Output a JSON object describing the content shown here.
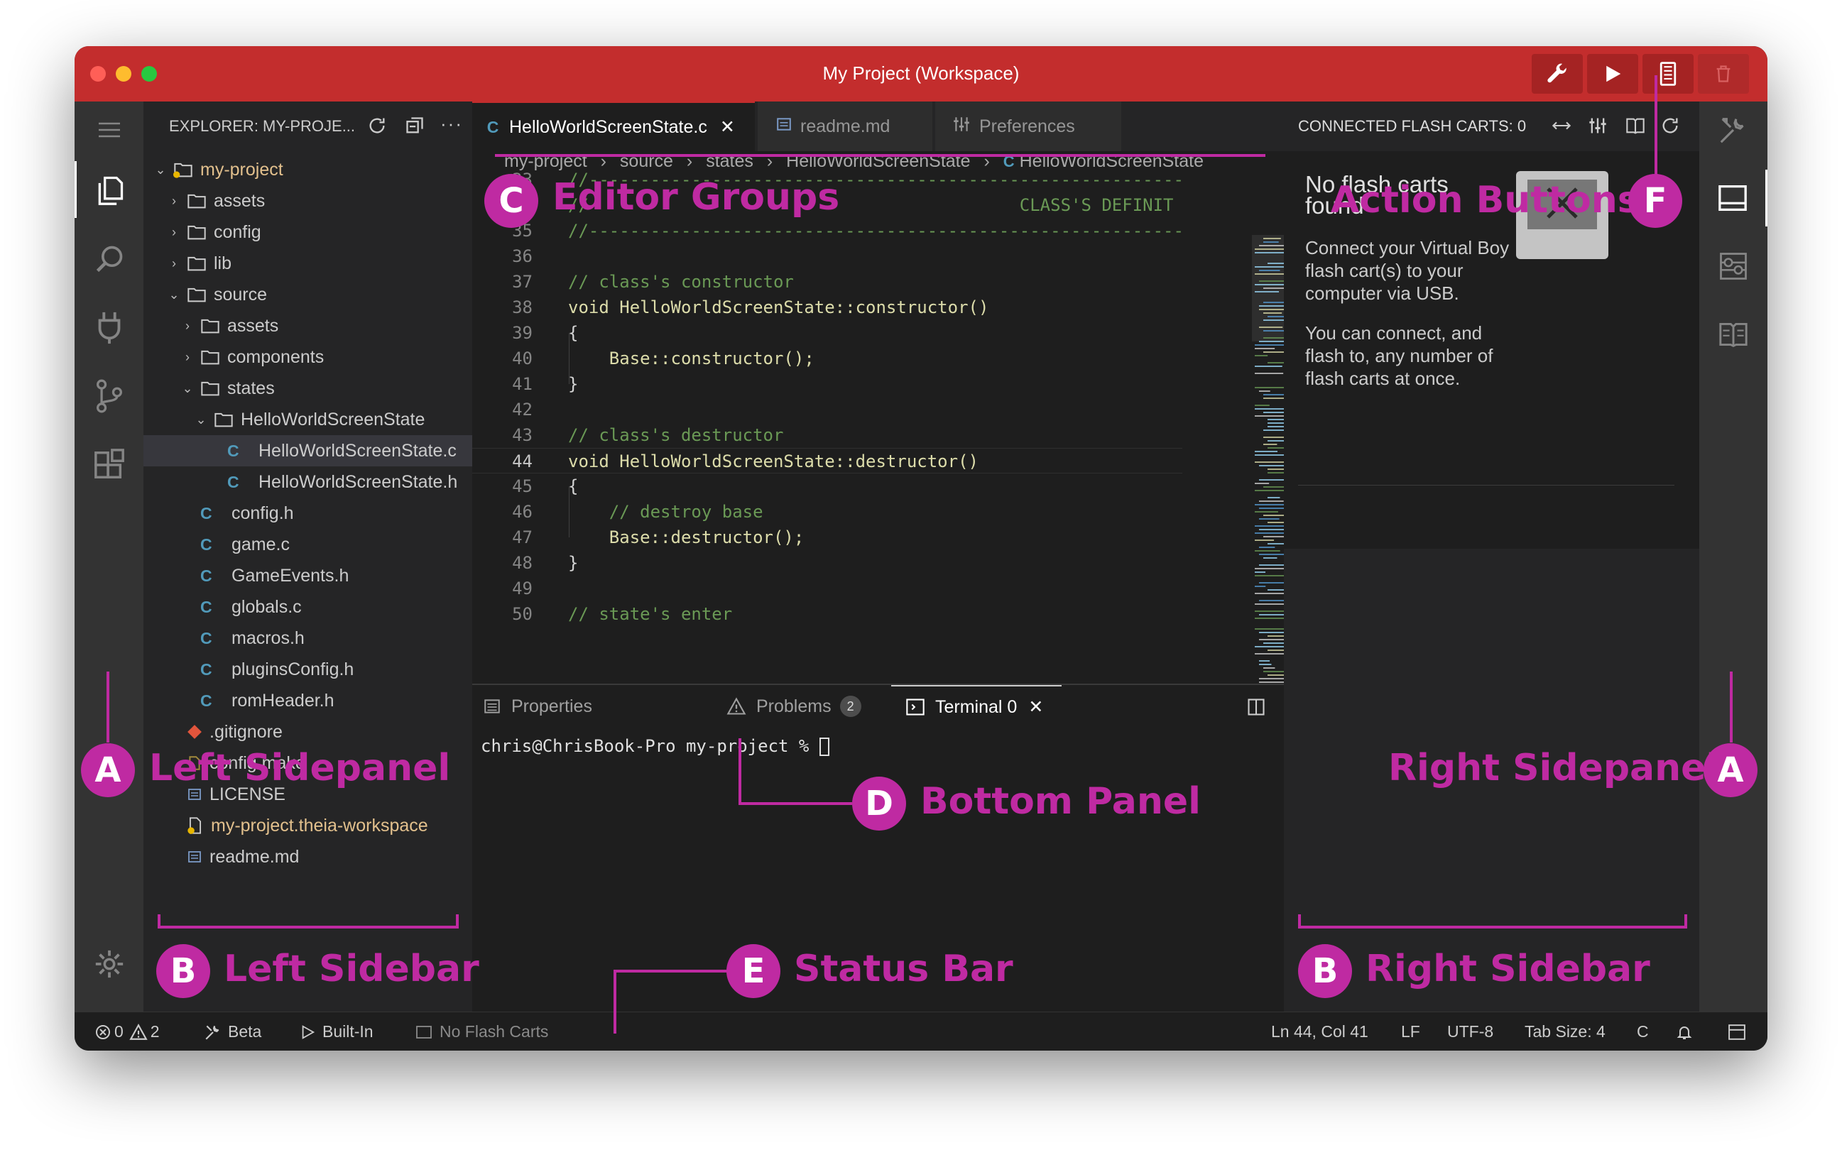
{
  "window": {
    "title": "My Project (Workspace)",
    "traffic_colors": [
      "#ff5f57",
      "#febc2e",
      "#28c840"
    ],
    "titlebar_buttons": [
      "wrench-icon",
      "play-icon",
      "flash-cart-icon",
      "trash-icon"
    ]
  },
  "activity_bar": [
    "menu-icon",
    "explorer-icon",
    "search-icon",
    "plug-icon",
    "source-control-icon",
    "extensions-icon",
    "settings-icon"
  ],
  "left_sidebar": {
    "header": "EXPLORER: MY-PROJE...",
    "tree": [
      {
        "label": "my-project",
        "type": "root",
        "indent": 0
      },
      {
        "label": "assets",
        "type": "folder",
        "indent": 1
      },
      {
        "label": "config",
        "type": "folder",
        "indent": 1
      },
      {
        "label": "lib",
        "type": "folder",
        "indent": 1
      },
      {
        "label": "source",
        "type": "folder-open",
        "indent": 1
      },
      {
        "label": "assets",
        "type": "folder",
        "indent": 2
      },
      {
        "label": "components",
        "type": "folder",
        "indent": 2
      },
      {
        "label": "states",
        "type": "folder-open",
        "indent": 2
      },
      {
        "label": "HelloWorldScreenState",
        "type": "folder-open",
        "indent": 3
      },
      {
        "label": "HelloWorldScreenState.c",
        "type": "c",
        "indent": 4
      },
      {
        "label": "HelloWorldScreenState.h",
        "type": "c",
        "indent": 4
      },
      {
        "label": "config.h",
        "type": "c",
        "indent": 2
      },
      {
        "label": "game.c",
        "type": "c",
        "indent": 2
      },
      {
        "label": "GameEvents.h",
        "type": "c",
        "indent": 2
      },
      {
        "label": "globals.c",
        "type": "c",
        "indent": 2
      },
      {
        "label": "macros.h",
        "type": "c",
        "indent": 2
      },
      {
        "label": "pluginsConfig.h",
        "type": "c",
        "indent": 2
      },
      {
        "label": "romHeader.h",
        "type": "c",
        "indent": 2
      },
      {
        "label": ".gitignore",
        "type": "git",
        "indent": 1
      },
      {
        "label": "config.make",
        "type": "file",
        "indent": 1
      },
      {
        "label": "LICENSE",
        "type": "doc",
        "indent": 1
      },
      {
        "label": "my-project.theia-workspace",
        "type": "workspace",
        "indent": 1
      },
      {
        "label": "readme.md",
        "type": "doc",
        "indent": 1
      }
    ]
  },
  "editor": {
    "tabs": [
      {
        "label": "HelloWorldScreenState.c",
        "icon": "C"
      },
      {
        "label": "readme.md",
        "icon": "doc-icon"
      },
      {
        "label": "Preferences",
        "icon": "sliders-icon"
      }
    ],
    "breadcrumb": [
      "my-project",
      "source",
      "states",
      "HelloWorldScreenState",
      "HelloWorldScreenState"
    ],
    "lines": [
      {
        "n": "33",
        "text": "//-----------------------------------------------------------------------"
      },
      {
        "n": "34",
        "text": "//                                          CLASS'S DEFINIT"
      },
      {
        "n": "35",
        "text": "//-----------------------------------------------------------------------"
      },
      {
        "n": "36",
        "text": ""
      },
      {
        "n": "37",
        "text": "// class's constructor"
      },
      {
        "n": "38",
        "text": "void HelloWorldScreenState::constructor()"
      },
      {
        "n": "39",
        "text": "{"
      },
      {
        "n": "40",
        "text": "    Base::constructor();"
      },
      {
        "n": "41",
        "text": "}"
      },
      {
        "n": "42",
        "text": ""
      },
      {
        "n": "43",
        "text": "// class's destructor"
      },
      {
        "n": "44",
        "text": "void HelloWorldScreenState::destructor()"
      },
      {
        "n": "45",
        "text": "{"
      },
      {
        "n": "46",
        "text": "    // destroy base"
      },
      {
        "n": "47",
        "text": "    Base::destructor();"
      },
      {
        "n": "48",
        "text": "}"
      },
      {
        "n": "49",
        "text": ""
      },
      {
        "n": "50",
        "text": "// state's enter"
      }
    ]
  },
  "bottom_panel": {
    "tabs": [
      {
        "label": "Properties"
      },
      {
        "label": "Problems",
        "badge": "2"
      },
      {
        "label": "Terminal 0"
      }
    ],
    "terminal_prompt": "chris@ChrisBook-Pro my-project % "
  },
  "right_sidebar": {
    "header": "CONNECTED FLASH CARTS: 0",
    "not_found": "No flash carts found",
    "text1": "Connect your Virtual Boy flash cart(s) to your computer via USB.",
    "text2": "You can connect, and flash to, any number of flash carts at once."
  },
  "right_activity": [
    "tools-icon",
    "panel-icon",
    "emulator-icon",
    "book-icon"
  ],
  "status_bar": {
    "errors": "0",
    "warnings": "2",
    "beta": "Beta",
    "built_in": "Built-In",
    "flash_carts": "No Flash Carts",
    "position": "Ln 44, Col 41",
    "eol": "LF",
    "encoding": "UTF-8",
    "tab_size": "Tab Size: 4",
    "language": "C"
  },
  "annotations": {
    "A": "A",
    "B": "B",
    "C": "C",
    "D": "D",
    "E": "E",
    "F": "F",
    "left_sidepanel": "Left Sidepanel",
    "right_sidepanel": "Right Sidepanel",
    "left_sidebar": "Left Sidebar",
    "right_sidebar": "Right Sidebar",
    "editor_groups": "Editor Groups",
    "bottom_panel": "Bottom Panel",
    "status_bar": "Status Bar",
    "action_buttons": "Action Buttons",
    "color": "#bf2aa2"
  }
}
